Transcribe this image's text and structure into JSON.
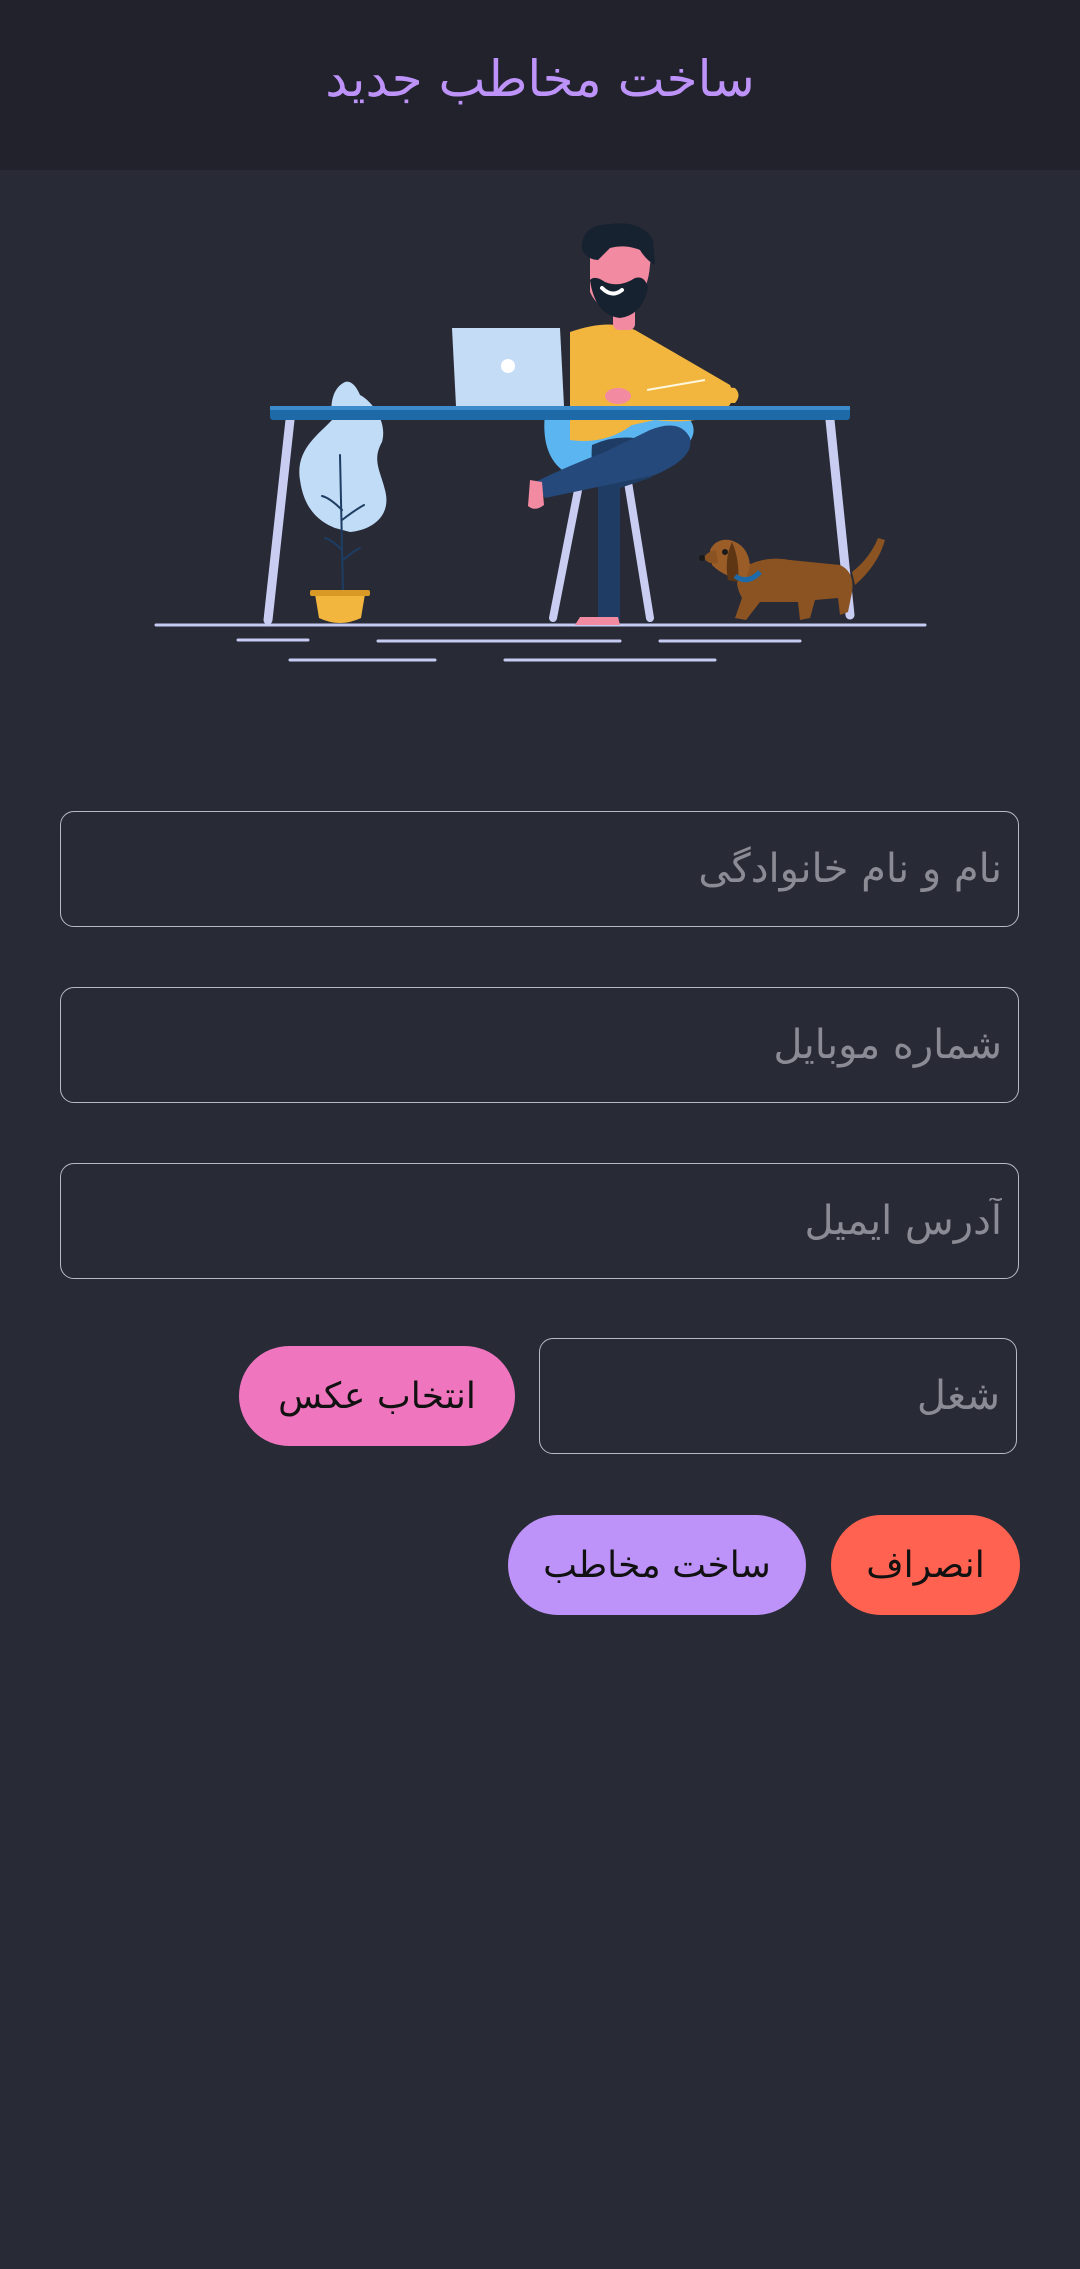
{
  "header": {
    "title": "ساخت مخاطب جدید"
  },
  "form": {
    "name_placeholder": "نام و نام خانوادگی",
    "mobile_placeholder": "شماره موبایل",
    "email_placeholder": "آدرس ایمیل",
    "job_placeholder": "شغل",
    "choose_photo_label": "انتخاب عکس",
    "create_label": "ساخت مخاطب",
    "cancel_label": "انصراف"
  },
  "colors": {
    "background": "#282a36",
    "header_bg": "#21222c",
    "title": "#bd93f9",
    "photo_button": "#f075bf",
    "create_button": "#bd93f9",
    "cancel_button": "#ff6250"
  },
  "illustration": {
    "description_icon": "person-at-desk-with-laptop-plant-dog-illustration"
  }
}
